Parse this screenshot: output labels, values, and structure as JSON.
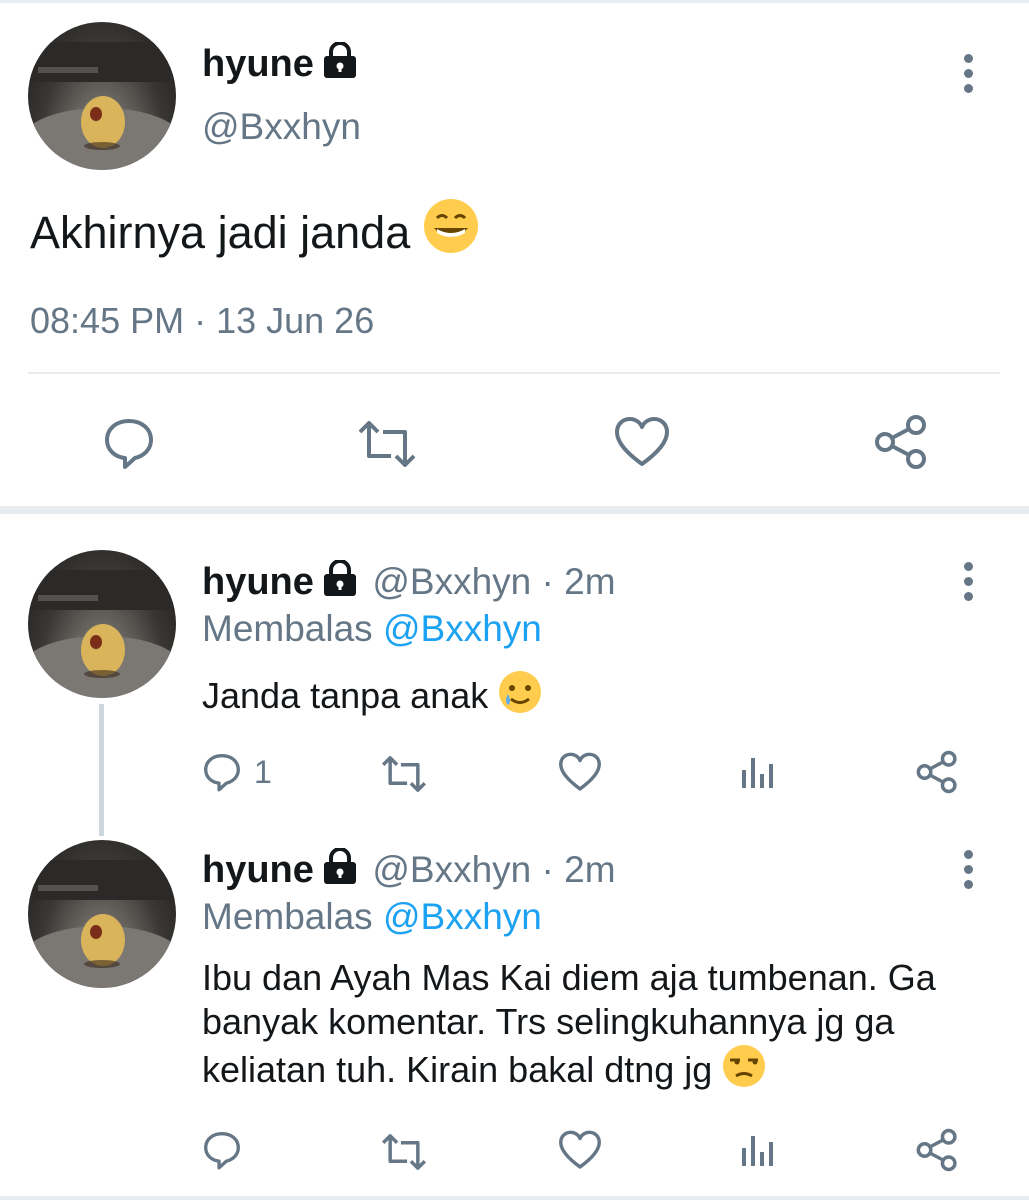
{
  "main_tweet": {
    "display_name": "hyune",
    "handle": "@Bxxhyn",
    "text": "Akhirnya jadi janda",
    "timestamp": "08:45 PM · 13 Jun 26"
  },
  "replies": [
    {
      "display_name": "hyune",
      "handle_time": "@Bxxhyn · 2m",
      "replying_label": "Membalas",
      "replying_to": "@Bxxhyn",
      "text": "Janda tanpa anak",
      "reply_count": "1"
    },
    {
      "display_name": "hyune",
      "handle_time": "@Bxxhyn · 2m",
      "replying_label": "Membalas",
      "replying_to": "@Bxxhyn",
      "text": "Ibu dan Ayah Mas Kai diem aja tumbenan. Ga banyak komentar. Trs selingkuhannya jg ga keliatan tuh. Kirain bakal dtng jg",
      "reply_count": ""
    }
  ],
  "icons": [
    "lock-icon",
    "more-icon",
    "reply-icon",
    "retweet-icon",
    "like-icon",
    "share-icon",
    "analytics-icon",
    "grin-emoji",
    "smile-tear-emoji",
    "unamused-emoji"
  ],
  "colors": {
    "text": "#14171a",
    "secondary": "#657786",
    "link": "#1da1f2",
    "divider": "#e6ecf0"
  }
}
